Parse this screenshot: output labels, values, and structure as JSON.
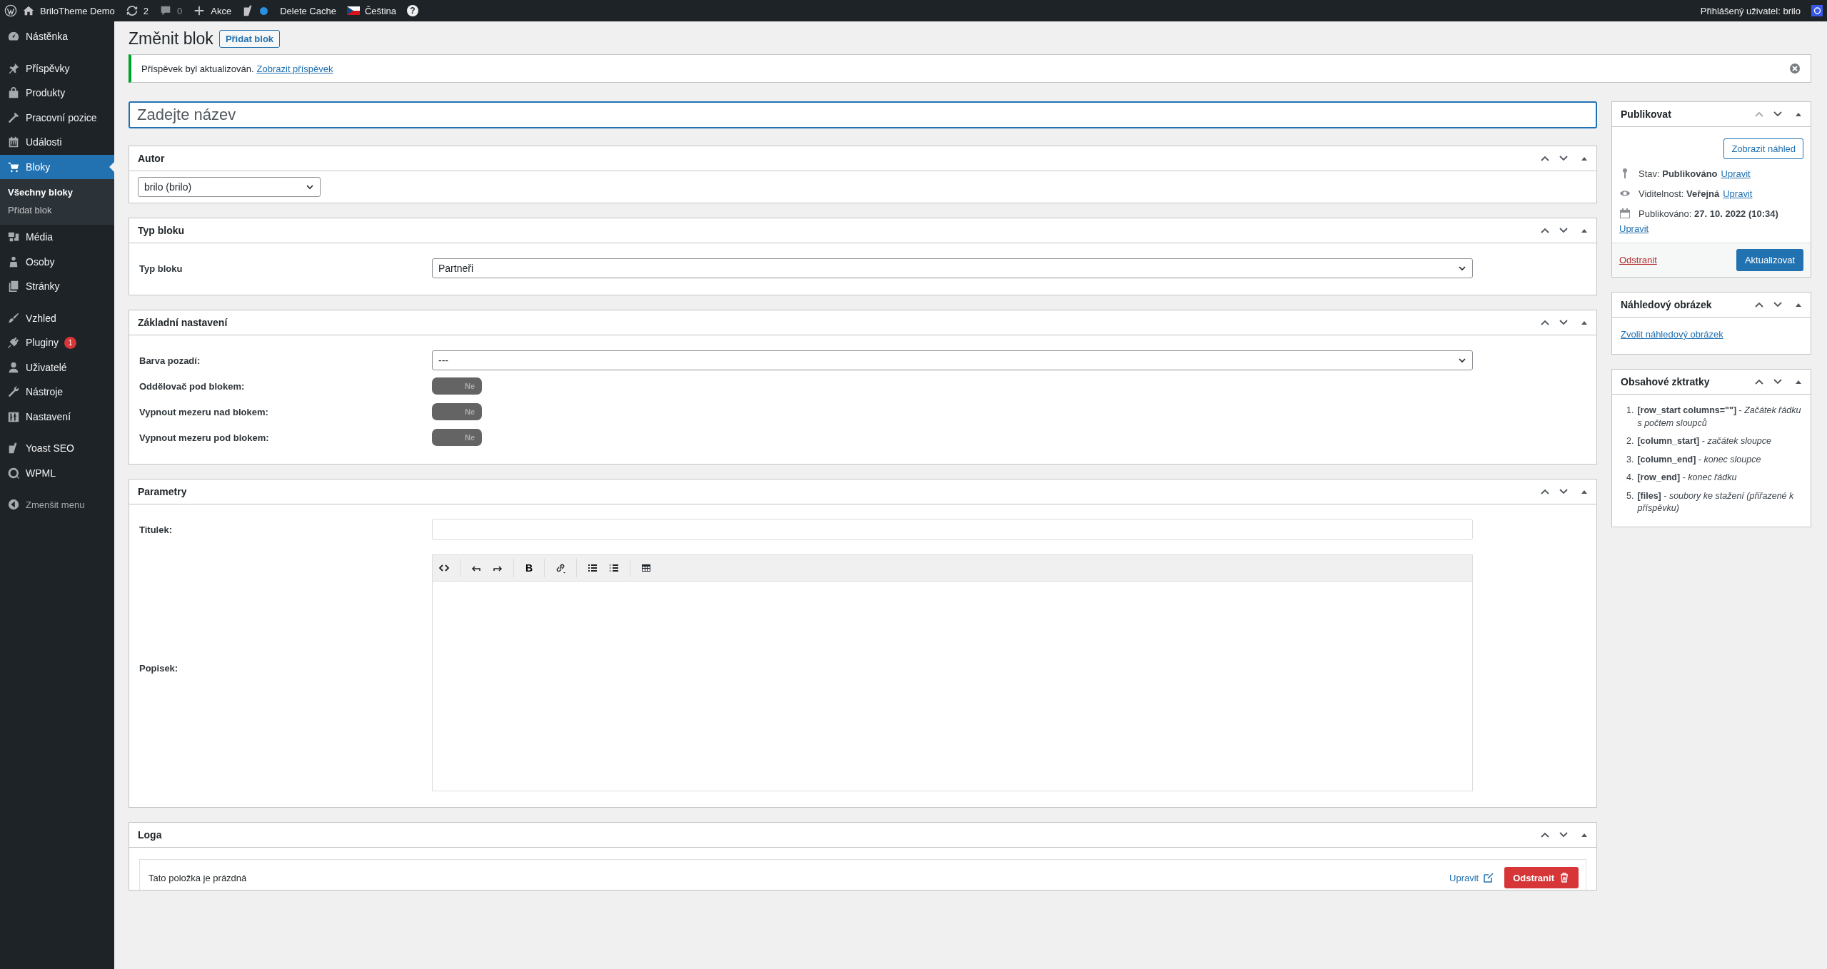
{
  "admin_bar": {
    "site": "BriloTheme Demo",
    "updates": "2",
    "comments": "0",
    "new": "Akce",
    "delete_cache": "Delete Cache",
    "language": "Čeština",
    "help": "?",
    "user": "Přihlášený uživatel: brilo"
  },
  "sidebar": {
    "groups": [
      [
        {
          "label": "Nástěnka",
          "selected": false
        }
      ],
      [
        {
          "label": "Příspěvky",
          "selected": false
        },
        {
          "label": "Produkty",
          "selected": false
        },
        {
          "label": "Pracovní pozice",
          "selected": false
        },
        {
          "label": "Události",
          "selected": false
        },
        {
          "label": "Bloky",
          "selected": true,
          "children": [
            {
              "label": "Všechny bloky",
              "selected": true
            },
            {
              "label": "Přidat blok",
              "selected": false
            }
          ]
        },
        {
          "label": "Média",
          "selected": false
        },
        {
          "label": "Osoby",
          "selected": false
        },
        {
          "label": "Stránky",
          "selected": false
        }
      ],
      [
        {
          "label": "Vzhled",
          "selected": false
        },
        {
          "label": "Pluginy",
          "selected": false,
          "badge": "1"
        },
        {
          "label": "Uživatelé",
          "selected": false
        },
        {
          "label": "Nástroje",
          "selected": false
        },
        {
          "label": "Nastavení",
          "selected": false
        }
      ],
      [
        {
          "label": "Yoast SEO",
          "selected": false
        },
        {
          "label": "WPML",
          "selected": false
        }
      ]
    ],
    "collapse": "Zmenšit menu"
  },
  "page": {
    "title": "Změnit blok",
    "add_button": "Přidat blok"
  },
  "notice": {
    "text": "Příspěvek byl aktualizován.",
    "link": "Zobrazit příspěvek"
  },
  "title_field": {
    "placeholder": "Zadejte název"
  },
  "boxes": [
    {
      "title": "Autor",
      "kind": "select",
      "value": "brilo (brilo)"
    },
    {
      "title": "Typ bloku",
      "kind": "fields",
      "fields": [
        {
          "kind": "select",
          "label": "Typ bloku",
          "value": "Partneři"
        }
      ]
    },
    {
      "title": "Základní nastavení",
      "kind": "fields",
      "fields": [
        {
          "kind": "select",
          "label": "Barva pozadí:",
          "value": "---"
        },
        {
          "kind": "toggle",
          "label": "Oddělovač pod blokem:",
          "on": false,
          "text": "Ne"
        },
        {
          "kind": "toggle",
          "label": "Vypnout mezeru nad blokem:",
          "on": false,
          "text": "Ne"
        },
        {
          "kind": "toggle",
          "label": "Vypnout mezeru pod blokem:",
          "on": false,
          "text": "Ne"
        }
      ]
    },
    {
      "title": "Parametry",
      "kind": "fields",
      "fields": [
        {
          "kind": "text",
          "label": "Titulek:"
        },
        {
          "kind": "editor",
          "label": "Popisek:",
          "bold_key": "B"
        }
      ]
    },
    {
      "title": "Loga",
      "kind": "repeater",
      "empty_text": "Tato položka je prázdná",
      "edit": "Upravit",
      "remove": "Odstranit"
    }
  ],
  "publish": {
    "title": "Publikovat",
    "preview": "Zobrazit náhled",
    "status": "Stav: **Publikováno**",
    "visibility": "Viditelnost: **Veřejná**",
    "published": "Publikováno: **27. 10. 2022 (10:34)**",
    "status_edit": "Upravit",
    "visibility_edit": "Upravit",
    "date_edit": "Upravit",
    "delete": "Odstranit",
    "update": "Aktualizovat"
  },
  "featured_image": {
    "title": "Náhledový obrázek",
    "link": "Zvolit náhledový obrázek"
  },
  "shortcuts": {
    "title": "Obsahové zktratky",
    "items": [
      {
        "number": "1.",
        "text": "**[row_start columns=\"\"]** - *Začátek řádku s počtem sloupců*"
      },
      {
        "number": "2.",
        "text": "**[column_start]** - *začátek sloupce*"
      },
      {
        "number": "3.",
        "text": "**[column_end]** - *konec sloupce*"
      },
      {
        "number": "4.",
        "text": "**[row_end]** - *konec řádku*"
      },
      {
        "number": "5.",
        "text": "**[files]** - *soubory ke stažení (přiřazené k příspěvku)*"
      }
    ]
  }
}
